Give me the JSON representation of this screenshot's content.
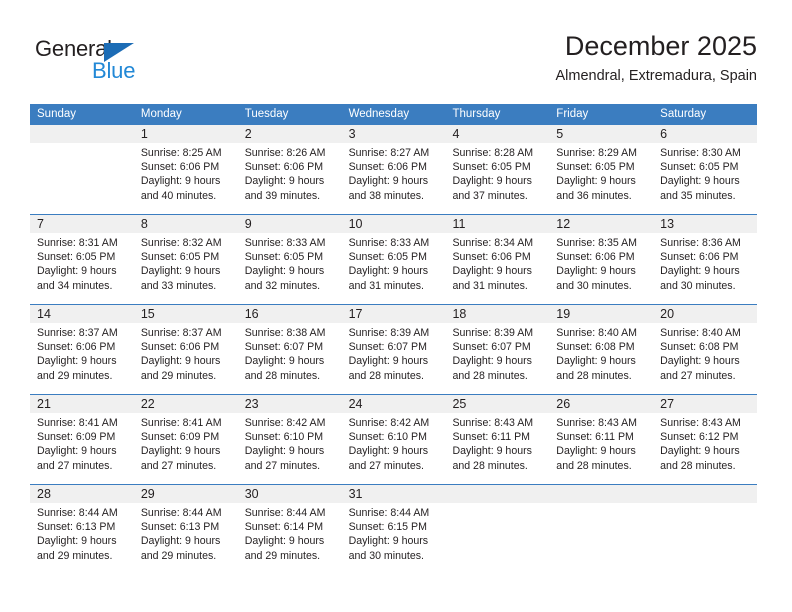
{
  "brand": {
    "name_top": "General",
    "name_bottom": "Blue",
    "triangle_color": "#1c6cb5",
    "blue_color": "#2288d6"
  },
  "header": {
    "month_year": "December 2025",
    "location": "Almendral, Extremadura, Spain"
  },
  "colors": {
    "header_band": "#3b7dc0",
    "daynum_band": "#f0f0f0",
    "text": "#231f20"
  },
  "weekdays": [
    "Sunday",
    "Monday",
    "Tuesday",
    "Wednesday",
    "Thursday",
    "Friday",
    "Saturday"
  ],
  "weeks": [
    [
      {
        "day": "",
        "lines": []
      },
      {
        "day": "1",
        "lines": [
          "Sunrise: 8:25 AM",
          "Sunset: 6:06 PM",
          "Daylight: 9 hours",
          "and 40 minutes."
        ]
      },
      {
        "day": "2",
        "lines": [
          "Sunrise: 8:26 AM",
          "Sunset: 6:06 PM",
          "Daylight: 9 hours",
          "and 39 minutes."
        ]
      },
      {
        "day": "3",
        "lines": [
          "Sunrise: 8:27 AM",
          "Sunset: 6:06 PM",
          "Daylight: 9 hours",
          "and 38 minutes."
        ]
      },
      {
        "day": "4",
        "lines": [
          "Sunrise: 8:28 AM",
          "Sunset: 6:05 PM",
          "Daylight: 9 hours",
          "and 37 minutes."
        ]
      },
      {
        "day": "5",
        "lines": [
          "Sunrise: 8:29 AM",
          "Sunset: 6:05 PM",
          "Daylight: 9 hours",
          "and 36 minutes."
        ]
      },
      {
        "day": "6",
        "lines": [
          "Sunrise: 8:30 AM",
          "Sunset: 6:05 PM",
          "Daylight: 9 hours",
          "and 35 minutes."
        ]
      }
    ],
    [
      {
        "day": "7",
        "lines": [
          "Sunrise: 8:31 AM",
          "Sunset: 6:05 PM",
          "Daylight: 9 hours",
          "and 34 minutes."
        ]
      },
      {
        "day": "8",
        "lines": [
          "Sunrise: 8:32 AM",
          "Sunset: 6:05 PM",
          "Daylight: 9 hours",
          "and 33 minutes."
        ]
      },
      {
        "day": "9",
        "lines": [
          "Sunrise: 8:33 AM",
          "Sunset: 6:05 PM",
          "Daylight: 9 hours",
          "and 32 minutes."
        ]
      },
      {
        "day": "10",
        "lines": [
          "Sunrise: 8:33 AM",
          "Sunset: 6:05 PM",
          "Daylight: 9 hours",
          "and 31 minutes."
        ]
      },
      {
        "day": "11",
        "lines": [
          "Sunrise: 8:34 AM",
          "Sunset: 6:06 PM",
          "Daylight: 9 hours",
          "and 31 minutes."
        ]
      },
      {
        "day": "12",
        "lines": [
          "Sunrise: 8:35 AM",
          "Sunset: 6:06 PM",
          "Daylight: 9 hours",
          "and 30 minutes."
        ]
      },
      {
        "day": "13",
        "lines": [
          "Sunrise: 8:36 AM",
          "Sunset: 6:06 PM",
          "Daylight: 9 hours",
          "and 30 minutes."
        ]
      }
    ],
    [
      {
        "day": "14",
        "lines": [
          "Sunrise: 8:37 AM",
          "Sunset: 6:06 PM",
          "Daylight: 9 hours",
          "and 29 minutes."
        ]
      },
      {
        "day": "15",
        "lines": [
          "Sunrise: 8:37 AM",
          "Sunset: 6:06 PM",
          "Daylight: 9 hours",
          "and 29 minutes."
        ]
      },
      {
        "day": "16",
        "lines": [
          "Sunrise: 8:38 AM",
          "Sunset: 6:07 PM",
          "Daylight: 9 hours",
          "and 28 minutes."
        ]
      },
      {
        "day": "17",
        "lines": [
          "Sunrise: 8:39 AM",
          "Sunset: 6:07 PM",
          "Daylight: 9 hours",
          "and 28 minutes."
        ]
      },
      {
        "day": "18",
        "lines": [
          "Sunrise: 8:39 AM",
          "Sunset: 6:07 PM",
          "Daylight: 9 hours",
          "and 28 minutes."
        ]
      },
      {
        "day": "19",
        "lines": [
          "Sunrise: 8:40 AM",
          "Sunset: 6:08 PM",
          "Daylight: 9 hours",
          "and 28 minutes."
        ]
      },
      {
        "day": "20",
        "lines": [
          "Sunrise: 8:40 AM",
          "Sunset: 6:08 PM",
          "Daylight: 9 hours",
          "and 27 minutes."
        ]
      }
    ],
    [
      {
        "day": "21",
        "lines": [
          "Sunrise: 8:41 AM",
          "Sunset: 6:09 PM",
          "Daylight: 9 hours",
          "and 27 minutes."
        ]
      },
      {
        "day": "22",
        "lines": [
          "Sunrise: 8:41 AM",
          "Sunset: 6:09 PM",
          "Daylight: 9 hours",
          "and 27 minutes."
        ]
      },
      {
        "day": "23",
        "lines": [
          "Sunrise: 8:42 AM",
          "Sunset: 6:10 PM",
          "Daylight: 9 hours",
          "and 27 minutes."
        ]
      },
      {
        "day": "24",
        "lines": [
          "Sunrise: 8:42 AM",
          "Sunset: 6:10 PM",
          "Daylight: 9 hours",
          "and 27 minutes."
        ]
      },
      {
        "day": "25",
        "lines": [
          "Sunrise: 8:43 AM",
          "Sunset: 6:11 PM",
          "Daylight: 9 hours",
          "and 28 minutes."
        ]
      },
      {
        "day": "26",
        "lines": [
          "Sunrise: 8:43 AM",
          "Sunset: 6:11 PM",
          "Daylight: 9 hours",
          "and 28 minutes."
        ]
      },
      {
        "day": "27",
        "lines": [
          "Sunrise: 8:43 AM",
          "Sunset: 6:12 PM",
          "Daylight: 9 hours",
          "and 28 minutes."
        ]
      }
    ],
    [
      {
        "day": "28",
        "lines": [
          "Sunrise: 8:44 AM",
          "Sunset: 6:13 PM",
          "Daylight: 9 hours",
          "and 29 minutes."
        ]
      },
      {
        "day": "29",
        "lines": [
          "Sunrise: 8:44 AM",
          "Sunset: 6:13 PM",
          "Daylight: 9 hours",
          "and 29 minutes."
        ]
      },
      {
        "day": "30",
        "lines": [
          "Sunrise: 8:44 AM",
          "Sunset: 6:14 PM",
          "Daylight: 9 hours",
          "and 29 minutes."
        ]
      },
      {
        "day": "31",
        "lines": [
          "Sunrise: 8:44 AM",
          "Sunset: 6:15 PM",
          "Daylight: 9 hours",
          "and 30 minutes."
        ]
      },
      {
        "day": "",
        "lines": []
      },
      {
        "day": "",
        "lines": []
      },
      {
        "day": "",
        "lines": []
      }
    ]
  ]
}
